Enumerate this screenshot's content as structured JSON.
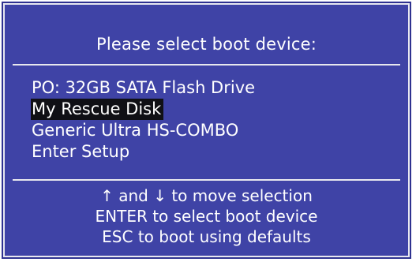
{
  "boot_menu": {
    "title": "Please select boot device:",
    "devices": [
      {
        "label": "PO: 32GB SATA Flash Drive",
        "selected": false
      },
      {
        "label": "My Rescue Disk",
        "selected": true
      },
      {
        "label": "Generic Ultra HS-COMBO",
        "selected": false
      },
      {
        "label": "Enter Setup",
        "selected": false
      }
    ],
    "help": [
      "↑ and ↓ to move selection",
      "ENTER to select boot device",
      "ESC to boot using defaults"
    ]
  },
  "colors": {
    "background": "#3f43a6",
    "text": "#ffffff",
    "selection_highlight": "#101015",
    "divider": "#e8e8ee"
  }
}
